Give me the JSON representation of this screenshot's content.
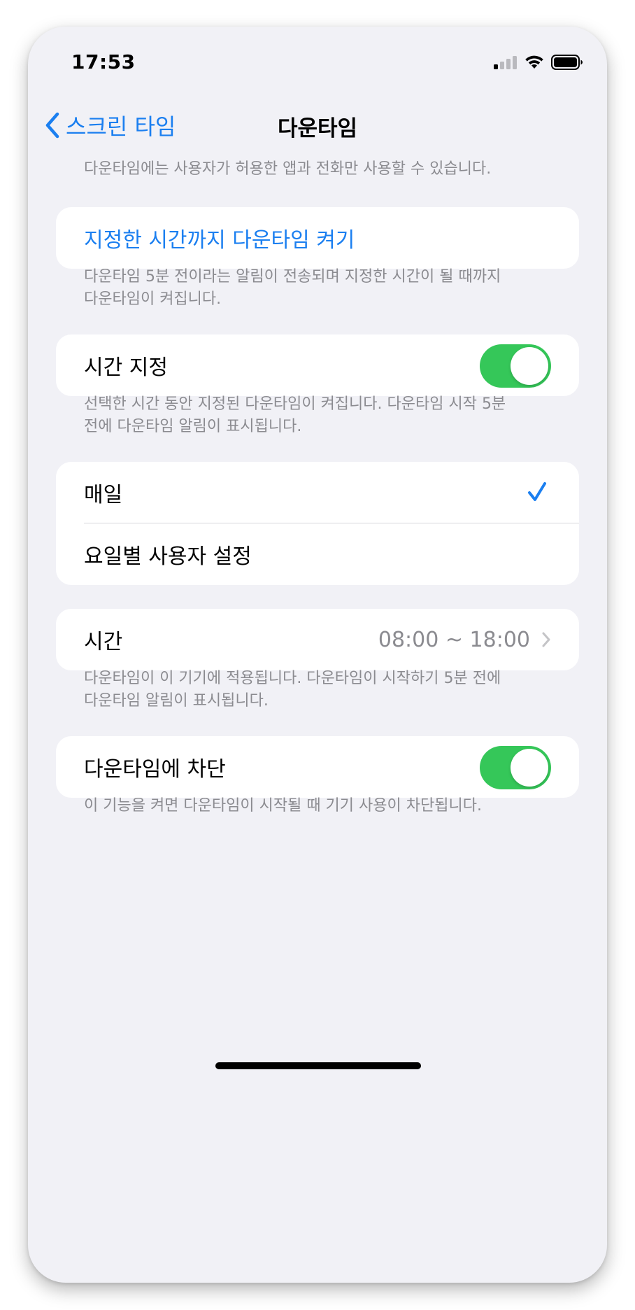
{
  "status_bar": {
    "time": "17:53"
  },
  "nav": {
    "back_label": "스크린 타임",
    "title": "다운타임"
  },
  "intro_text": "다운타임에는 사용자가 허용한 앱과 전화만 사용할 수 있습니다.",
  "turn_on_until": {
    "label": "지정한 시간까지 다운타임 켜기",
    "footnote_1": "다운타임 5분 전이라는 알림이 전송되며 지정한 시간이 될 때까지",
    "footnote_2": "다운타임이 켜집니다."
  },
  "scheduled": {
    "label": "시간 지정",
    "on": true,
    "footnote_1": "선택한 시간 동안 지정된 다운타임이 켜집니다. 다운타임 시작 5분",
    "footnote_2": "전에 다운타임 알림이 표시됩니다."
  },
  "schedule_options": [
    {
      "label": "매일",
      "selected": true
    },
    {
      "label": "요일별 사용자 설정",
      "selected": false
    }
  ],
  "time_row": {
    "label": "시간",
    "value": "08:00 ~ 18:00",
    "footnote_1": "다운타임이 이 기기에 적용됩니다. 다운타임이 시작하기 5분 전에",
    "footnote_2": "다운타임 알림이 표시됩니다."
  },
  "block_at_downtime": {
    "label": "다운타임에 차단",
    "on": true,
    "footnote": "이 기능을 켜면 다운타임이 시작될 때 기기 사용이 차단됩니다."
  },
  "colors": {
    "accent": "#1b7ff0",
    "toggle_on": "#35c759",
    "secondary_text": "#8b8b90",
    "background": "#f1f1f6"
  }
}
